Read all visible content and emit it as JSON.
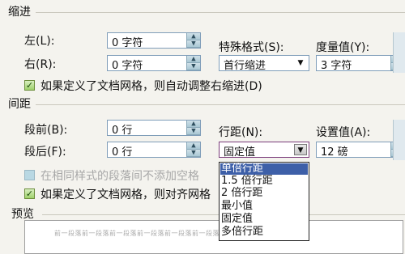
{
  "indent": {
    "section": "缩进",
    "left_label": "左(L):",
    "left_value": "0 字符",
    "right_label": "右(R):",
    "right_value": "0 字符",
    "special_label": "特殊格式(S):",
    "special_value": "首行缩进",
    "amount_label": "度量值(Y):",
    "amount_value": "3 字符",
    "grid_checkbox": "如果定义了文档网格，则自动调整右缩进(D)"
  },
  "spacing": {
    "section": "间距",
    "before_label": "段前(B):",
    "before_value": "0 行",
    "after_label": "段后(F):",
    "after_value": "0 行",
    "line_label": "行距(N):",
    "line_value": "固定值",
    "setting_label": "设置值(A):",
    "setting_value": "12 磅",
    "same_style_checkbox": "在相同样式的段落间不添加空格",
    "grid_checkbox": "如果定义了文档网格，则对齐网格"
  },
  "line_spacing_options": [
    "单倍行距",
    "1.5 倍行距",
    "2 倍行距",
    "最小值",
    "固定值",
    "多倍行距"
  ],
  "preview": {
    "section": "预览",
    "text": "前一段落前一段落前一段落前一段落前一段落前一段落前一段落前一段落前一段落"
  }
}
